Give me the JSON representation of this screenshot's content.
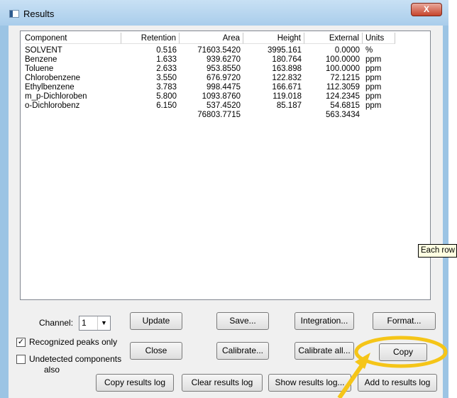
{
  "window": {
    "title": "Results",
    "close_glyph": "X"
  },
  "table": {
    "headers": [
      "Component",
      "Retention",
      "Area",
      "Height",
      "External",
      "Units"
    ],
    "rows": [
      [
        "SOLVENT",
        "0.516",
        "71603.5420",
        "3995.161",
        "0.0000",
        "%"
      ],
      [
        "Benzene",
        "1.633",
        "939.6270",
        "180.764",
        "100.0000",
        "ppm"
      ],
      [
        "Toluene",
        "2.633",
        "953.8550",
        "163.898",
        "100.0000",
        "ppm"
      ],
      [
        "Chlorobenzene",
        "3.550",
        "676.9720",
        "122.832",
        "72.1215",
        "ppm"
      ],
      [
        "Ethylbenzene",
        "3.783",
        "998.4475",
        "166.671",
        "112.3059",
        "ppm"
      ],
      [
        "m_p-Dichloroben",
        "5.800",
        "1093.8760",
        "119.018",
        "124.2345",
        "ppm"
      ],
      [
        "o-Dichlorobenz",
        "6.150",
        "537.4520",
        "85.187",
        "54.6815",
        "ppm"
      ]
    ],
    "totals": {
      "area": "76803.7715",
      "external": "563.3434"
    }
  },
  "controls": {
    "channel_label": "Channel:",
    "channel_value": "1",
    "recognized_label": "Recognized peaks only",
    "recognized_checked": "✓",
    "undetected_label_1": "Undetected components",
    "undetected_label_2": "also"
  },
  "buttons": {
    "update": "Update",
    "save": "Save...",
    "integration": "Integration...",
    "format": "Format...",
    "close": "Close",
    "calibrate": "Calibrate...",
    "calibrate_all": "Calibrate all...",
    "copy": "Copy",
    "copy_results_log": "Copy results log",
    "clear_results_log": "Clear results log",
    "show_results_log": "Show results log...",
    "add_to_results_log": "Add to results log"
  },
  "tooltip": "Each row",
  "colors": {
    "highlight": "#f5c518",
    "title_bar": "#a9cdeb"
  }
}
